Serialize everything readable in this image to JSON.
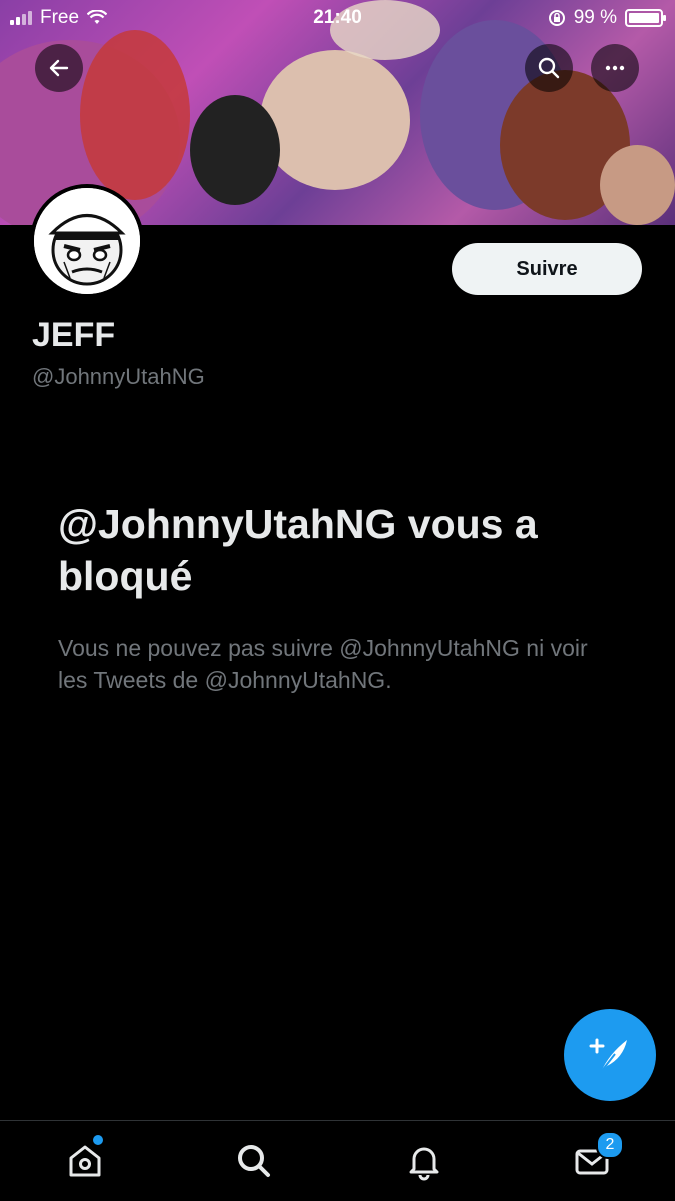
{
  "status_bar": {
    "carrier": "Free",
    "time": "21:40",
    "battery": "99 %",
    "battery_level": 0.99
  },
  "profile": {
    "display_name": "JEFF",
    "handle": "@JohnnyUtahNG",
    "follow_label": "Suivre"
  },
  "blocked": {
    "title": "@JohnnyUtahNG vous a bloqué",
    "description": "Vous ne pouvez pas suivre @JohnnyUtahNG ni voir les Tweets de @JohnnyUtahNG."
  },
  "tabs": [
    {
      "icon": "home-icon",
      "has_dot": true
    },
    {
      "icon": "search-icon"
    },
    {
      "icon": "bell-icon"
    },
    {
      "icon": "mail-icon",
      "badge": "2"
    }
  ],
  "colors": {
    "accent": "#1d9bf0",
    "background": "#000000",
    "muted_text": "#71767b"
  }
}
